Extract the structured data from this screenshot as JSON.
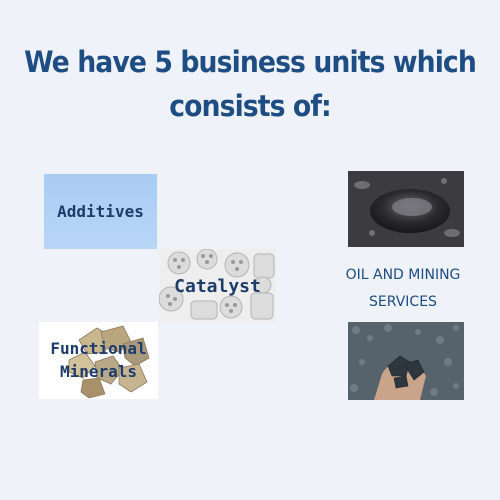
{
  "heading": {
    "line1": "We have 5 business units which",
    "line2": "consists of:"
  },
  "units": {
    "additives": {
      "label": "Additives"
    },
    "catalyst": {
      "label": "Catalyst"
    },
    "functional_minerals": {
      "line1": "Functional",
      "line2": "Minerals"
    },
    "oil_and_mining": {
      "line1": "OIL AND MINING",
      "line2": "SERVICES"
    }
  },
  "colors": {
    "background": "#eff2f8",
    "heading": "#1e4d84",
    "tile_text": "#1e3c6a",
    "additives_tile": "#b0d0f5"
  }
}
